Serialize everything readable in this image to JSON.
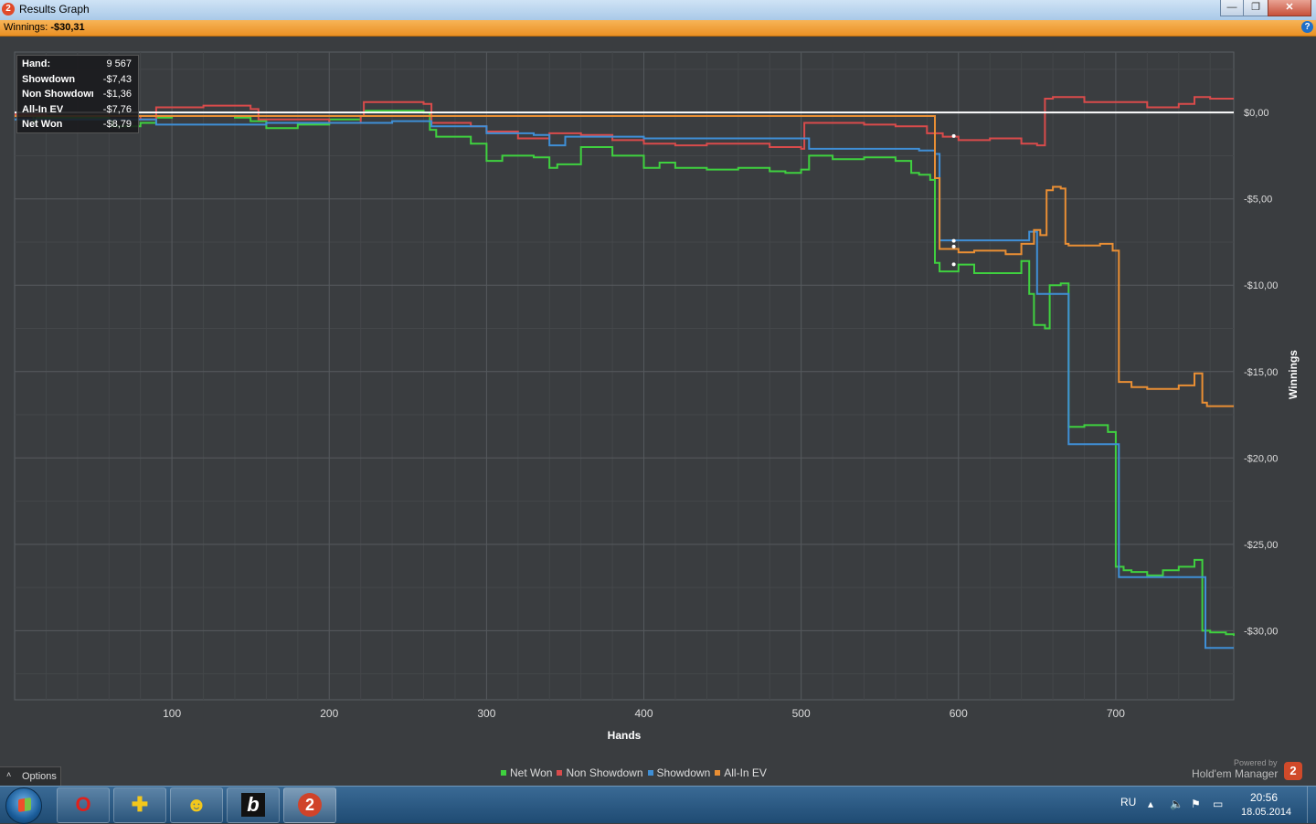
{
  "window": {
    "title": "Results Graph",
    "logo_text": "2",
    "minimize_glyph": "—",
    "maximize_glyph": "❐",
    "close_glyph": "✕"
  },
  "summary": {
    "winnings_label": "Winnings:",
    "winnings_value": "-$30,31",
    "help_glyph": "?"
  },
  "tooltip": {
    "rows": [
      {
        "label": "Hand:",
        "value": "9 567"
      },
      {
        "label": "Showdown",
        "value": "-$7,43"
      },
      {
        "label": "Non Showdown",
        "value": "-$1,36"
      },
      {
        "label": "All-In EV",
        "value": "-$7,76"
      },
      {
        "label": "Net Won",
        "value": "-$8,79"
      }
    ]
  },
  "colors": {
    "net_won": "#3fd13f",
    "non_showdown": "#d94b4b",
    "showdown": "#3f8fd6",
    "all_in_ev": "#ea8f34",
    "zero_line": "#ffffff",
    "grid": "#55595d",
    "plot_bg": "#3a3d40"
  },
  "chart_data": {
    "type": "line",
    "xlabel": "Hands",
    "ylabel": "Winnings",
    "xlim": [
      0,
      775
    ],
    "ylim": [
      -34,
      3.5
    ],
    "xticks": [
      100,
      200,
      300,
      400,
      500,
      600,
      700
    ],
    "yticks": [
      0,
      -5,
      -10,
      -15,
      -20,
      -25,
      -30
    ],
    "ytick_labels": [
      "$0,00",
      "-$5,00",
      "-$10,00",
      "-$15,00",
      "-$20,00",
      "-$25,00",
      "-$30,00"
    ],
    "grid": true,
    "legend_position": "bottom-center",
    "series": [
      {
        "name": "Net Won",
        "color_key": "net_won",
        "x": [
          0,
          12,
          14,
          60,
          62,
          80,
          90,
          100,
          140,
          150,
          160,
          180,
          200,
          220,
          222,
          260,
          264,
          268,
          290,
          300,
          310,
          330,
          340,
          345,
          360,
          380,
          400,
          410,
          420,
          440,
          460,
          480,
          490,
          500,
          505,
          520,
          540,
          560,
          570,
          575,
          582,
          585,
          588,
          600,
          610,
          640,
          645,
          648,
          655,
          658,
          665,
          670,
          680,
          695,
          700,
          705,
          710,
          720,
          730,
          740,
          750,
          755,
          760,
          770,
          775
        ],
        "y": [
          -0.2,
          -0.5,
          -0.3,
          -0.4,
          -0.8,
          -0.6,
          -0.3,
          -0.2,
          -0.3,
          -0.5,
          -0.9,
          -0.7,
          -0.4,
          -0.2,
          0.1,
          0.0,
          -1.0,
          -1.4,
          -1.8,
          -2.8,
          -2.5,
          -2.6,
          -3.2,
          -3.0,
          -2.0,
          -2.5,
          -3.2,
          -2.9,
          -3.2,
          -3.3,
          -3.2,
          -3.4,
          -3.5,
          -3.3,
          -2.5,
          -2.7,
          -2.6,
          -2.8,
          -3.5,
          -3.6,
          -3.9,
          -8.7,
          -9.2,
          -8.8,
          -9.3,
          -8.6,
          -10.5,
          -12.3,
          -12.5,
          -10.0,
          -9.9,
          -18.2,
          -18.1,
          -18.5,
          -26.3,
          -26.5,
          -26.6,
          -26.8,
          -26.5,
          -26.3,
          -25.9,
          -30.0,
          -30.1,
          -30.2,
          -30.3
        ]
      },
      {
        "name": "Non Showdown",
        "color_key": "non_showdown",
        "x": [
          0,
          20,
          60,
          80,
          90,
          120,
          150,
          155,
          200,
          220,
          222,
          260,
          265,
          290,
          300,
          320,
          340,
          360,
          380,
          400,
          420,
          440,
          480,
          500,
          502,
          540,
          560,
          580,
          590,
          600,
          620,
          640,
          650,
          655,
          660,
          680,
          700,
          720,
          740,
          750,
          760,
          775
        ],
        "y": [
          -0.1,
          0.0,
          -0.2,
          -0.4,
          0.3,
          0.4,
          0.2,
          -0.4,
          -0.6,
          -0.2,
          0.6,
          0.5,
          -0.6,
          -0.8,
          -1.1,
          -1.5,
          -1.2,
          -1.3,
          -1.6,
          -1.8,
          -1.9,
          -1.8,
          -2.0,
          -2.1,
          -0.6,
          -0.7,
          -0.8,
          -1.2,
          -1.4,
          -1.6,
          -1.5,
          -1.8,
          -1.9,
          0.8,
          0.9,
          0.6,
          0.6,
          0.3,
          0.5,
          0.9,
          0.8,
          0.8
        ]
      },
      {
        "name": "Showdown",
        "color_key": "showdown",
        "x": [
          0,
          90,
          160,
          240,
          265,
          300,
          330,
          340,
          350,
          400,
          500,
          505,
          575,
          585,
          588,
          640,
          645,
          650,
          668,
          670,
          700,
          702,
          755,
          757,
          775
        ],
        "y": [
          -0.4,
          -0.7,
          -0.6,
          -0.5,
          -0.8,
          -1.2,
          -1.3,
          -1.9,
          -1.4,
          -1.5,
          -1.5,
          -2.1,
          -2.2,
          -2.4,
          -7.4,
          -7.4,
          -6.9,
          -10.5,
          -10.5,
          -19.2,
          -19.2,
          -26.9,
          -26.9,
          -31.0,
          -31.0
        ]
      },
      {
        "name": "All-In EV",
        "color_key": "all_in_ev",
        "x": [
          0,
          585,
          588,
          600,
          610,
          630,
          640,
          648,
          652,
          656,
          660,
          665,
          668,
          670,
          690,
          698,
          702,
          710,
          720,
          740,
          750,
          755,
          758,
          775
        ],
        "y": [
          -0.2,
          -3.8,
          -7.9,
          -8.1,
          -8.0,
          -8.2,
          -7.6,
          -6.8,
          -7.1,
          -4.5,
          -4.3,
          -4.4,
          -7.6,
          -7.7,
          -7.6,
          -8.0,
          -15.6,
          -15.9,
          -16.0,
          -15.8,
          -15.1,
          -16.8,
          -17.0,
          -17.0
        ]
      }
    ]
  },
  "options": {
    "label": "Options",
    "chevron": "˄"
  },
  "branding": {
    "powered_by": "Powered by",
    "product": "Hold'em Manager",
    "logo_text": "2"
  },
  "taskbar": {
    "apps": [
      {
        "name": "opera",
        "glyph": "O",
        "color": "#e0201b"
      },
      {
        "name": "app-2",
        "glyph": "✚",
        "color": "#f2c71c"
      },
      {
        "name": "app-3",
        "glyph": "☻",
        "color": "#f2c71c"
      },
      {
        "name": "bodog",
        "glyph": "b",
        "color": "#ffffff"
      },
      {
        "name": "holdem-manager",
        "glyph": "2",
        "color": "#ffffff"
      }
    ],
    "language": "RU",
    "time": "20:56",
    "date": "18.05.2014"
  }
}
